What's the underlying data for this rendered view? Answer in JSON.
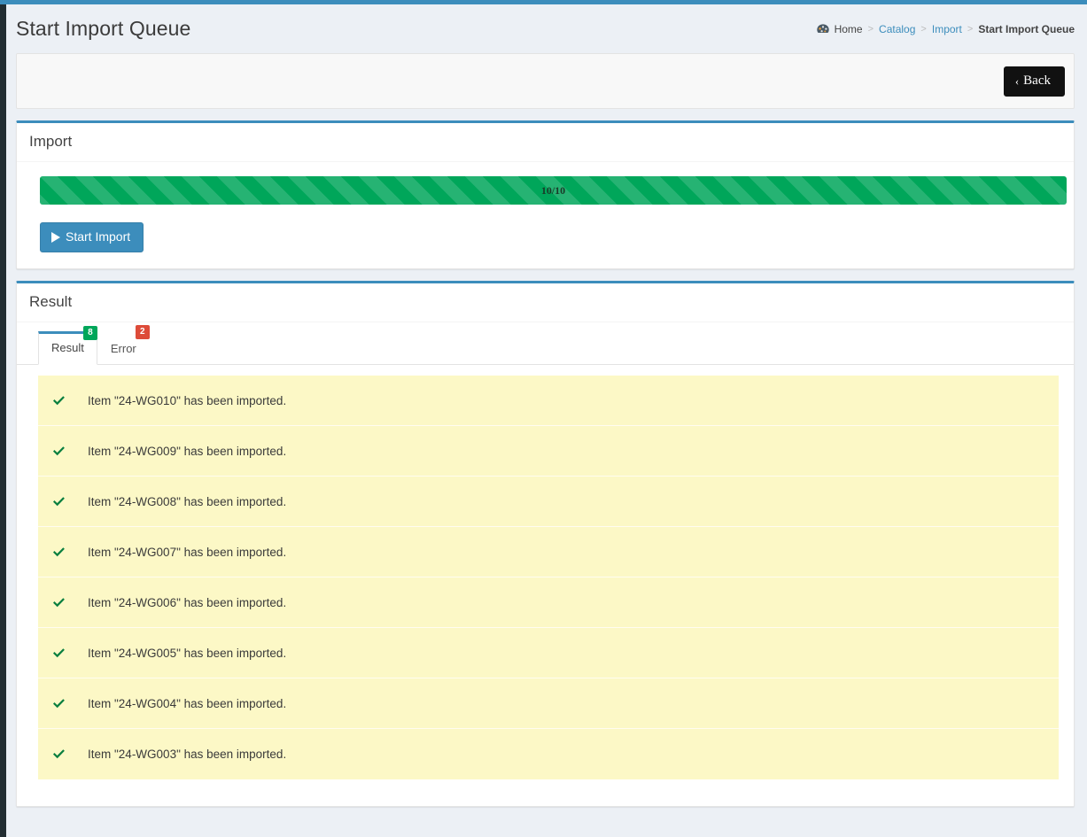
{
  "theme": {
    "accent": "#3c8dbc",
    "success": "#00a65a",
    "danger": "#dd4b39",
    "page_bg": "#ecf0f5",
    "list_row_bg": "#fcf8c6",
    "rail": "#222d32"
  },
  "header": {
    "title": "Start Import Queue",
    "breadcrumb": [
      {
        "label": "Home",
        "icon": "dashboard-icon",
        "active": false
      },
      {
        "label": "Catalog",
        "active": false
      },
      {
        "label": "Import",
        "active": false
      },
      {
        "label": "Start Import Queue",
        "active": true
      }
    ],
    "separator": ">"
  },
  "toolbar": {
    "back_label": "Back",
    "back_icon": "chevron-left-icon"
  },
  "import_panel": {
    "title": "Import",
    "progress": {
      "text": "10/10",
      "value": 10,
      "max": 10,
      "percent": 100,
      "striped": true,
      "color": "#00a65a"
    },
    "start_button": {
      "label": "Start Import",
      "icon": "play-icon"
    }
  },
  "result_panel": {
    "title": "Result",
    "tabs": [
      {
        "label": "Result",
        "badge": "8",
        "badge_color": "#00a65a",
        "active": true
      },
      {
        "label": "Error",
        "badge": "2",
        "badge_color": "#dd4b39",
        "active": false
      }
    ],
    "items": [
      {
        "icon": "check-icon",
        "text": "Item \"24-WG010\" has been imported."
      },
      {
        "icon": "check-icon",
        "text": "Item \"24-WG009\" has been imported."
      },
      {
        "icon": "check-icon",
        "text": "Item \"24-WG008\" has been imported."
      },
      {
        "icon": "check-icon",
        "text": "Item \"24-WG007\" has been imported."
      },
      {
        "icon": "check-icon",
        "text": "Item \"24-WG006\" has been imported."
      },
      {
        "icon": "check-icon",
        "text": "Item \"24-WG005\" has been imported."
      },
      {
        "icon": "check-icon",
        "text": "Item \"24-WG004\" has been imported."
      },
      {
        "icon": "check-icon",
        "text": "Item \"24-WG003\" has been imported."
      }
    ]
  }
}
